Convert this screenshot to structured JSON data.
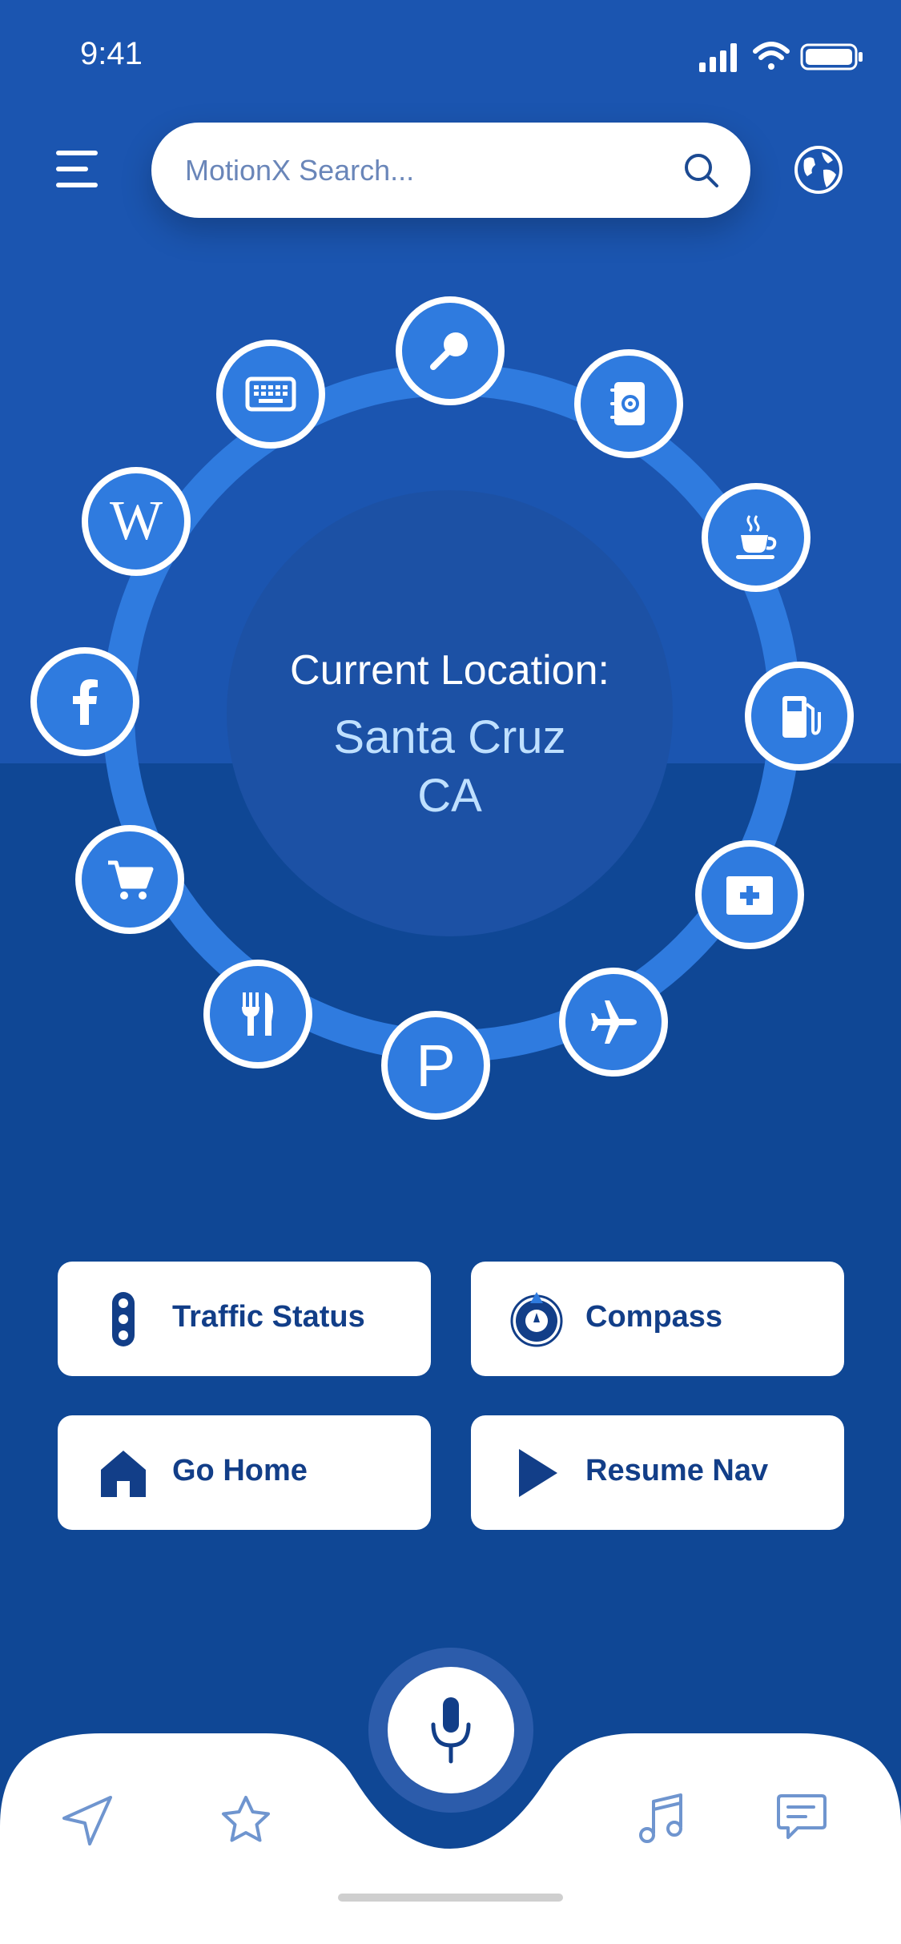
{
  "status_bar": {
    "time": "9:41"
  },
  "search": {
    "placeholder": "MotionX Search..."
  },
  "location": {
    "label": "Current Location:",
    "city": "Santa Cruz",
    "state": "CA"
  },
  "ring_items": [
    {
      "name": "search",
      "icon": "magnifier-icon"
    },
    {
      "name": "contacts",
      "icon": "address-book-icon"
    },
    {
      "name": "coffee",
      "icon": "coffee-cup-icon"
    },
    {
      "name": "gas",
      "icon": "gas-pump-icon"
    },
    {
      "name": "medical",
      "icon": "first-aid-icon"
    },
    {
      "name": "airport",
      "icon": "airplane-icon"
    },
    {
      "name": "parking",
      "icon": "parking-icon"
    },
    {
      "name": "food",
      "icon": "fork-knife-icon"
    },
    {
      "name": "shopping",
      "icon": "shopping-cart-icon"
    },
    {
      "name": "facebook",
      "icon": "facebook-icon"
    },
    {
      "name": "wikipedia",
      "icon": "wikipedia-icon"
    },
    {
      "name": "keyboard",
      "icon": "keyboard-icon"
    }
  ],
  "ring_text": {
    "parking": "P",
    "wikipedia": "W"
  },
  "quick_actions": {
    "traffic": "Traffic Status",
    "compass": "Compass",
    "home": "Go Home",
    "resume": "Resume Nav"
  },
  "tab_bar": {
    "items": [
      "navigate-icon",
      "star-icon",
      "mic-icon",
      "music-note-icon",
      "chat-icon"
    ]
  },
  "colors": {
    "background_top": "#1b55b0",
    "background_bottom": "#0f4795",
    "ring": "#2f7bdf",
    "button_text": "#123e88",
    "location_value": "#bfe0ff"
  }
}
